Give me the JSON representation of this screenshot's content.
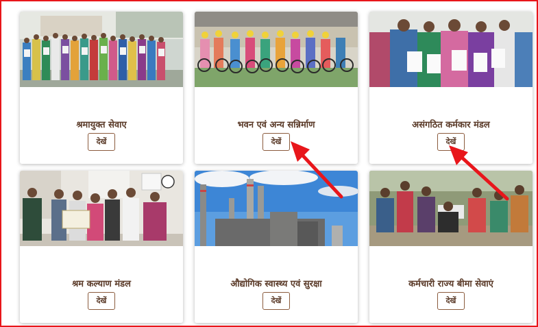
{
  "cards": [
    {
      "title": "श्रमायुक्त सेवाए",
      "button": "देखें"
    },
    {
      "title": "भवन एवं अन्य सन्निर्माण",
      "button": "देखें"
    },
    {
      "title": "असंगठित कर्मकार मंडल",
      "button": "देखें"
    },
    {
      "title": "श्रम कल्याण मंडल",
      "button": "देखें"
    },
    {
      "title": "औद्योगिक स्वास्थ्य एवं सुरक्षा",
      "button": "देखें"
    },
    {
      "title": "कर्मचारी राज्य बीमा सेवाएं",
      "button": "देखें"
    }
  ],
  "annotation_colors": {
    "arrow": "#e8161b",
    "frame": "#e8161b"
  }
}
